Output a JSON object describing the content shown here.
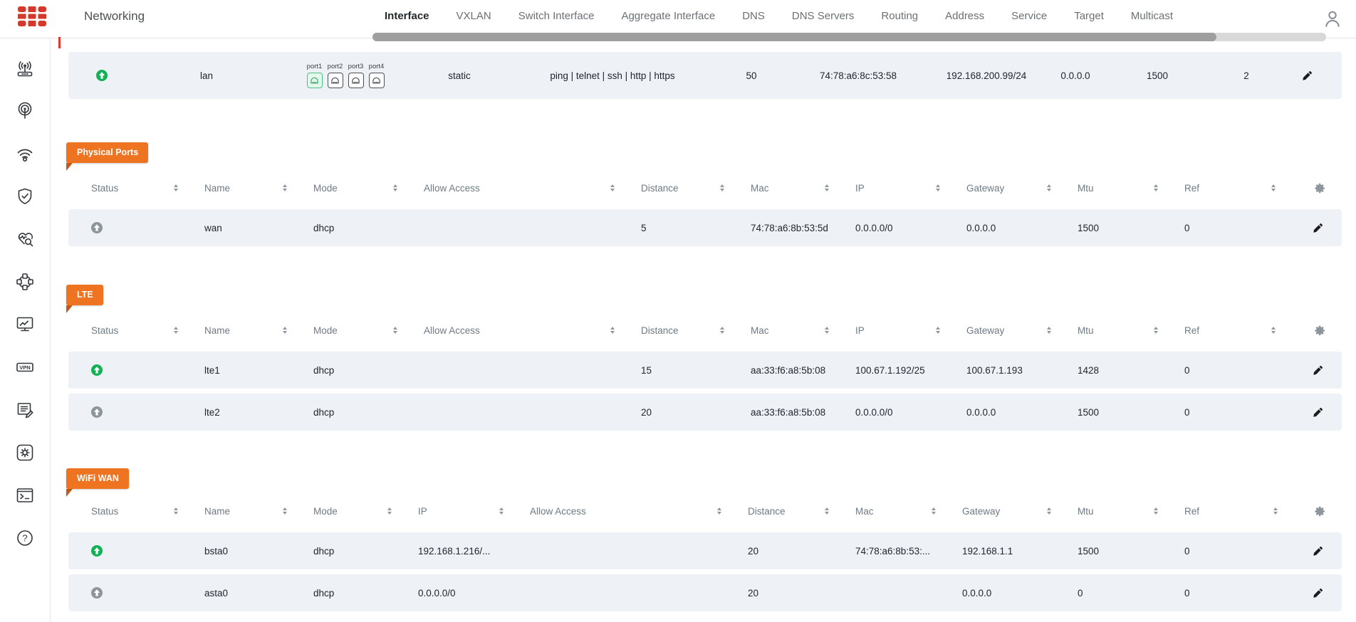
{
  "colors": {
    "accent_orange": "#ef7422",
    "badge_fold": "#c05a18",
    "logo_red": "#d6392b",
    "status_on_green": "#12b155",
    "status_off_gray": "#8d959d",
    "row_background": "#eef2f7",
    "header_text": "#6e7984",
    "tick_red": "#e8352c"
  },
  "topbar": {
    "title": "Networking",
    "tabs": [
      {
        "label": "Interface",
        "state": "active"
      },
      {
        "label": "VXLAN",
        "state": "inactive"
      },
      {
        "label": "Switch Interface",
        "state": "inactive"
      },
      {
        "label": "Aggregate Interface",
        "state": "inactive"
      },
      {
        "label": "DNS",
        "state": "inactive"
      },
      {
        "label": "DNS Servers",
        "state": "inactive"
      },
      {
        "label": "Routing",
        "state": "inactive"
      },
      {
        "label": "Address",
        "state": "inactive"
      },
      {
        "label": "Service",
        "state": "inactive"
      },
      {
        "label": "Target",
        "state": "inactive"
      },
      {
        "label": "Multicast",
        "state": "inactive"
      }
    ],
    "user_icon": "person-icon"
  },
  "sidebar": {
    "icons": [
      {
        "name": "wireless-router"
      },
      {
        "name": "broadcast-antenna"
      },
      {
        "name": "wifi"
      },
      {
        "name": "security-shield"
      },
      {
        "name": "health-check"
      },
      {
        "name": "network-topology"
      },
      {
        "name": "monitoring"
      },
      {
        "name": "vpn",
        "glyph": "VPN"
      },
      {
        "name": "logs-editor"
      },
      {
        "name": "settings"
      },
      {
        "name": "terminal"
      },
      {
        "name": "help",
        "glyph": "?"
      }
    ]
  },
  "interfaces_table": {
    "row": {
      "state": "on",
      "name": "lan",
      "ports": [
        {
          "label": "port1",
          "state": "on"
        },
        {
          "label": "port2",
          "state": "off"
        },
        {
          "label": "port3",
          "state": "off"
        },
        {
          "label": "port4",
          "state": "off"
        }
      ],
      "mode": "static",
      "allow_access": "ping | telnet | ssh | http | https",
      "distance": "50",
      "mac": "74:78:a6:8c:53:58",
      "ip": "192.168.200.99/24",
      "gateway": "0.0.0.0",
      "mtu": "1500",
      "ref": "2"
    }
  },
  "sections": [
    {
      "badge": "Physical Ports",
      "columns": [
        "Status",
        "Name",
        "Mode",
        "Allow Access",
        "Distance",
        "Mac",
        "IP",
        "Gateway",
        "Mtu",
        "Ref"
      ],
      "rows": [
        {
          "state": "off",
          "name": "wan",
          "mode": "dhcp",
          "allow_access": "",
          "distance": "5",
          "mac": "74:78:a6:8b:53:5d",
          "ip": "0.0.0.0/0",
          "gateway": "0.0.0.0",
          "mtu": "1500",
          "ref": "0"
        }
      ]
    },
    {
      "badge": "LTE",
      "columns": [
        "Status",
        "Name",
        "Mode",
        "Allow Access",
        "Distance",
        "Mac",
        "IP",
        "Gateway",
        "Mtu",
        "Ref"
      ],
      "rows": [
        {
          "state": "on",
          "name": "lte1",
          "mode": "dhcp",
          "allow_access": "",
          "distance": "15",
          "mac": "aa:33:f6:a8:5b:08",
          "ip": "100.67.1.192/25",
          "gateway": "100.67.1.193",
          "mtu": "1428",
          "ref": "0"
        },
        {
          "state": "off",
          "name": "lte2",
          "mode": "dhcp",
          "allow_access": "",
          "distance": "20",
          "mac": "aa:33:f6:a8:5b:08",
          "ip": "0.0.0.0/0",
          "gateway": "0.0.0.0",
          "mtu": "1500",
          "ref": "0"
        }
      ]
    },
    {
      "badge": "WiFi WAN",
      "columns": [
        "Status",
        "Name",
        "Mode",
        "IP",
        "Allow Access",
        "Distance",
        "Mac",
        "Gateway",
        "Mtu",
        "Ref"
      ],
      "rows": [
        {
          "state": "on",
          "name": "bsta0",
          "mode": "dhcp",
          "ip": "192.168.1.216/...",
          "allow_access": "",
          "distance": "20",
          "mac": "74:78:a6:8b:53:...",
          "gateway": "192.168.1.1",
          "mtu": "1500",
          "ref": "0"
        },
        {
          "state": "off",
          "name": "asta0",
          "mode": "dhcp",
          "ip": "0.0.0.0/0",
          "allow_access": "",
          "distance": "20",
          "mac": "",
          "gateway": "0.0.0.0",
          "mtu": "0",
          "ref": "0"
        }
      ]
    }
  ]
}
